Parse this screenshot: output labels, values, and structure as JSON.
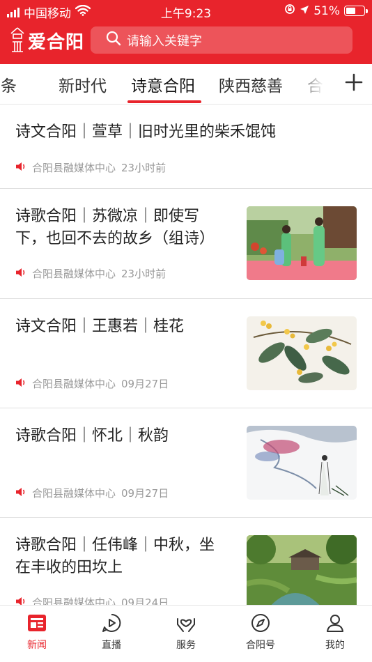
{
  "status_bar": {
    "carrier": "中国移动",
    "time": "上午9:23",
    "battery": "51%"
  },
  "header": {
    "app_name": "爱合阳",
    "search_placeholder": "请输入关键字"
  },
  "channels": {
    "items": [
      "头条",
      "新时代",
      "诗意合阳",
      "陕西慈善",
      "合阳"
    ],
    "active": "诗意合阳"
  },
  "articles": [
    {
      "title_lines": [
        "诗文合阳｜萱草｜旧时光里的柴禾馄饨"
      ],
      "source": "合阳县融媒体中心",
      "time": "23小时前",
      "thumb": "none"
    },
    {
      "title_lines": [
        "诗歌合阳｜苏微凉｜即使写",
        "下，也回不去的故乡（组诗）"
      ],
      "source": "合阳县融媒体中心",
      "time": "23小时前",
      "thumb": "opera-performers"
    },
    {
      "title_lines": [
        "诗文合阳｜王惠若｜桂花"
      ],
      "source": "合阳县融媒体中心",
      "time": "09月27日",
      "thumb": "osmanthus-painting"
    },
    {
      "title_lines": [
        "诗歌合阳｜怀北｜秋韵"
      ],
      "source": "合阳县融媒体中心",
      "time": "09月27日",
      "thumb": "ink-landscape"
    },
    {
      "title_lines": [
        "诗歌合阳｜任伟峰｜中秋，坐",
        "在丰收的田坎上"
      ],
      "source": "合阳县融媒体中心",
      "time": "09月24日",
      "thumb": "countryside-stream"
    }
  ],
  "tabbar": {
    "items": [
      {
        "label": "新闻",
        "icon": "news-icon"
      },
      {
        "label": "直播",
        "icon": "play-icon"
      },
      {
        "label": "服务",
        "icon": "heart-hands-icon"
      },
      {
        "label": "合阳号",
        "icon": "compass-icon"
      },
      {
        "label": "我的",
        "icon": "user-icon"
      }
    ],
    "active": "新闻"
  },
  "colors": {
    "brand_red": "#e8242c",
    "text_dark": "#222222",
    "text_meta": "#999999"
  }
}
